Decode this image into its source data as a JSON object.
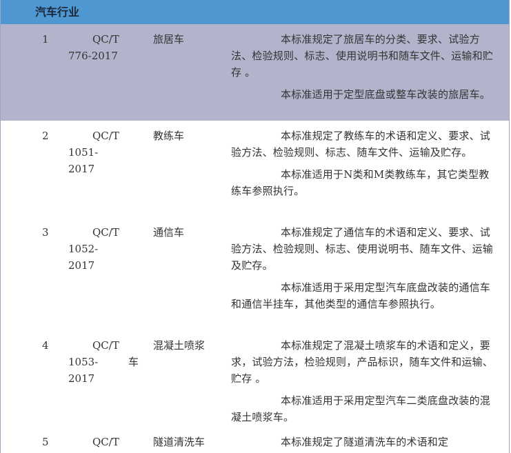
{
  "header": {
    "title": "汽车行业"
  },
  "rows": [
    {
      "num": "1",
      "code_a": "QC/T",
      "code_b": "776-2017",
      "code_c": "",
      "name": "旅居车",
      "desc1": "本标准规定了旅居车的分类、要求、试验方法、检验规则、标志、使用说明书和随车文件、运输和贮存 。",
      "desc2": "本标准适用于定型底盘或整车改装的旅居车。"
    },
    {
      "num": "2",
      "code_a": "QC/T",
      "code_b": "1051-",
      "code_c": "2017",
      "name": "教练车",
      "desc1": "本标准规定了教练车的术语和定义、要求、试验方法、检验规则、标志、随车文件、运输及贮存。",
      "desc2": "本标准适用于N类和M类教练车，其它类型教练车参照执行。"
    },
    {
      "num": "3",
      "code_a": "QC/T",
      "code_b": "1052-",
      "code_c": "2017",
      "name": "通信车",
      "desc1": "本标准规定了通信车的术语和定义、要求、试验方法、检验规则、标志、使用说明书、随车文件、运输及贮存。",
      "desc2": "本标准适用于采用定型汽车底盘改装的通信车和通信半挂车，其他类型的通信车参照执行。"
    },
    {
      "num": "4",
      "code_a": "QC/T",
      "code_b": "1053-",
      "code_c": "2017",
      "name": "混凝土喷浆",
      "name_b": "车",
      "desc1": "本标准规定了混凝土喷浆车的术语和定义，要求，试验方法，检验规则，产品标识，随车文件和运输、贮存 。",
      "desc2": "本标准适用于采用定型汽车二类底盘改装的混凝土喷浆车。"
    },
    {
      "num": "5",
      "code_a": "QC/T",
      "name": "隧道清洗车",
      "desc1": "本标准规定了隧道清洗车的术语和定"
    }
  ]
}
